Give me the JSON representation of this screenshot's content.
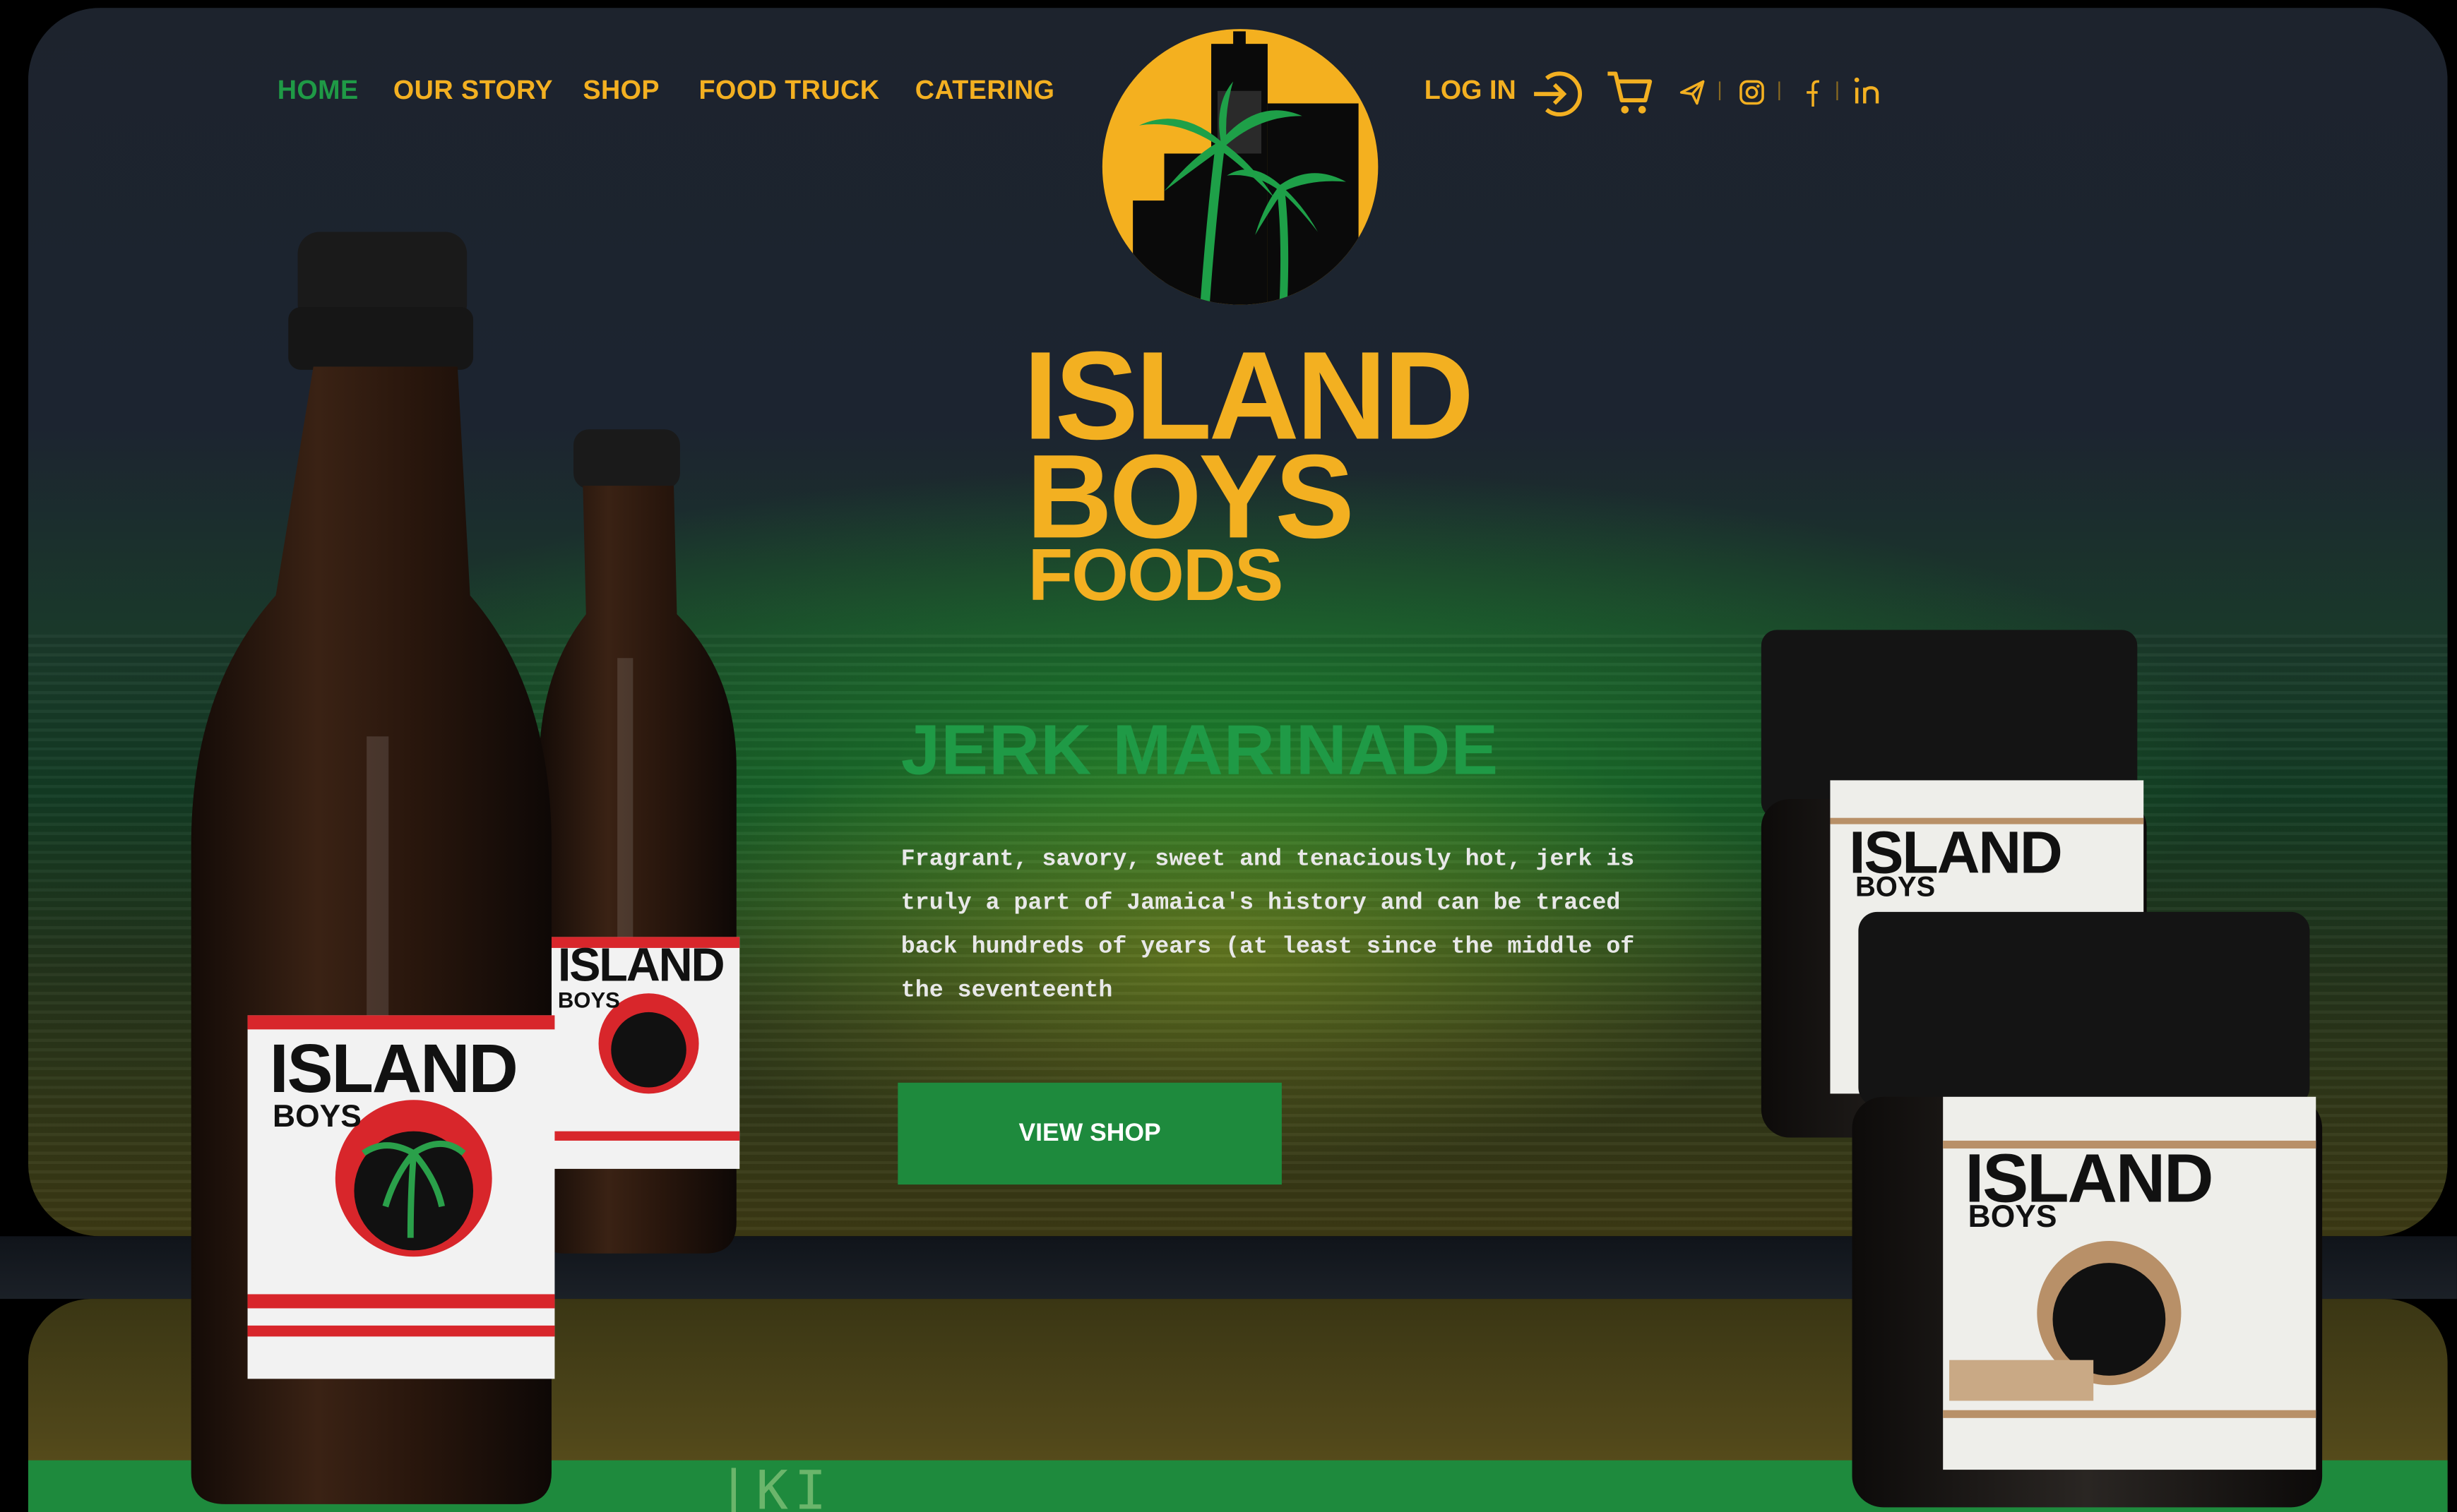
{
  "nav": {
    "items": [
      {
        "label": "HOME",
        "active": true
      },
      {
        "label": "OUR STORY",
        "active": false
      },
      {
        "label": "SHOP",
        "active": false
      },
      {
        "label": "FOOD TRUCK",
        "active": false
      },
      {
        "label": "CATERING",
        "active": false
      }
    ],
    "login_label": "LOG IN",
    "icons": [
      "login-arrow-icon",
      "cart-icon",
      "telegram-icon",
      "instagram-icon",
      "facebook-icon",
      "linkedin-icon"
    ]
  },
  "brand": {
    "line1": "ISLAND",
    "line2": "BOYS",
    "line3": "FOODS",
    "logo_alt": "palm-tree-skyline-logo"
  },
  "hero": {
    "title": "JERK MARINADE",
    "description": "Fragrant, savory, sweet and tenaciously hot, jerk is truly a part of Jamaica's history and can be traced back hundreds of years (at least since the middle of the seventeenth",
    "cta_label": "VIEW SHOP"
  },
  "products": {
    "bottle_label_line1": "ISLAND",
    "bottle_label_line2": "BOYS",
    "jar_label_line1": "ISLAND",
    "jar_label_line2": "BOYS"
  },
  "colors": {
    "accent_yellow": "#f3b021",
    "accent_green": "#1f9a46",
    "button_green": "#1e8a3d",
    "background_dark": "#1d232d"
  }
}
